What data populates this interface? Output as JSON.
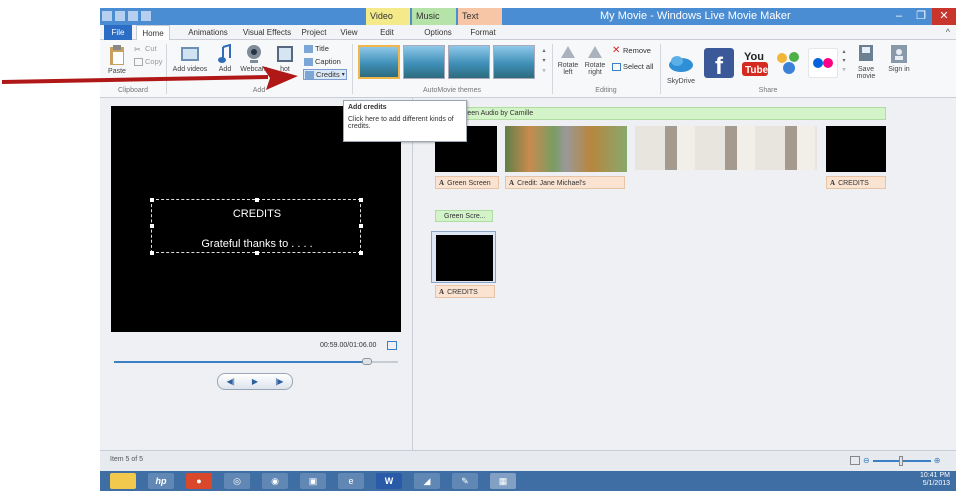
{
  "window": {
    "title": "My Movie - Windows Live Movie Maker",
    "context_tabs": [
      "Video Tools",
      "Music Tools",
      "Text Tools"
    ],
    "buttons": {
      "minimize": "–",
      "maximize": "❐",
      "close": "✕"
    }
  },
  "tabs": [
    "File",
    "Home",
    "Animations",
    "Visual Effects",
    "Project",
    "View",
    "Edit",
    "Options",
    "Format"
  ],
  "ribbon": {
    "clipboard": {
      "paste": "Paste",
      "cut": "Cut",
      "copy": "Copy",
      "group": "Clipboard"
    },
    "add": {
      "add_videos": "Add videos",
      "add_music": "Add",
      "webcam": "Webcam",
      "snapshot": "hot",
      "title": "Title",
      "caption": "Caption",
      "credits": "Credits",
      "group": "Add"
    },
    "themes": {
      "group": "AutoMovie themes"
    },
    "editing": {
      "rotate_left": "Rotate left",
      "rotate_right": "Rotate right",
      "remove": "Remove",
      "select_all": "Select all",
      "group": "Editing"
    },
    "share": {
      "skydrive": "SkyDrive",
      "save_movie": "Save movie",
      "sign_in": "Sign in",
      "group": "Share"
    }
  },
  "tooltip": {
    "title": "Add credits",
    "body": "Click here to add different kinds of credits."
  },
  "preview": {
    "credits_title": "CREDITS",
    "credits_text": "Grateful thanks to . . . .",
    "timecode": "00:59.00/01:06.00",
    "seek_fraction": 0.89,
    "controls": {
      "prev": "◀|",
      "play": "▶",
      "next": "|▶"
    }
  },
  "storyboard": {
    "audio_label": "reen Audio by Camille",
    "captions": [
      "Green Screen",
      "Credit: Jane Michael's",
      "CREDITS"
    ],
    "green_tag": "Green Scre...",
    "row2_caption": "CREDITS"
  },
  "status": {
    "item": "Item 5 of 5"
  },
  "tray": {
    "time": "10:41 PM",
    "date": "5/1/2013"
  },
  "colors": {
    "titlebar": "#4a8dd3",
    "accent": "#2b6cc4",
    "arrow": "#b01818"
  }
}
